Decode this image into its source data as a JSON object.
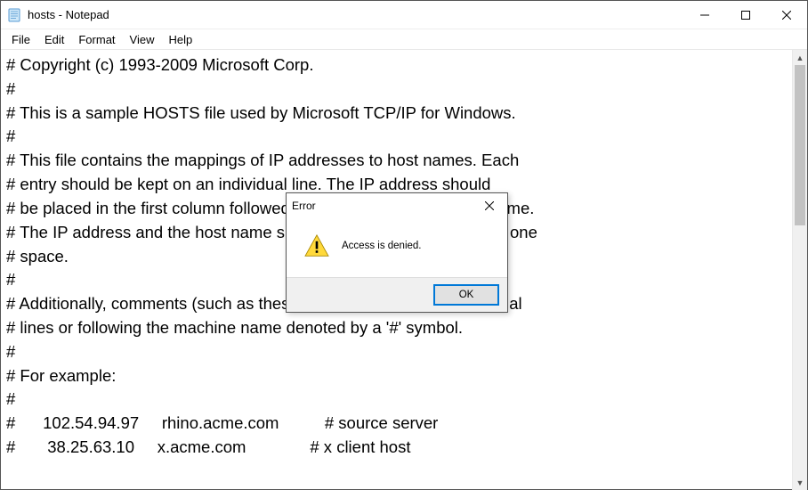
{
  "window": {
    "title": "hosts - Notepad"
  },
  "menu": {
    "file": "File",
    "edit": "Edit",
    "format": "Format",
    "view": "View",
    "help": "Help"
  },
  "editor": {
    "content": "# Copyright (c) 1993-2009 Microsoft Corp.\n#\n# This is a sample HOSTS file used by Microsoft TCP/IP for Windows.\n#\n# This file contains the mappings of IP addresses to host names. Each\n# entry should be kept on an individual line. The IP address should\n# be placed in the first column followed by the corresponding host name.\n# The IP address and the host name should be separated by at least one\n# space.\n#\n# Additionally, comments (such as these) may be inserted on individual\n# lines or following the machine name denoted by a '#' symbol.\n#\n# For example:\n#\n#      102.54.94.97     rhino.acme.com          # source server\n#       38.25.63.10     x.acme.com              # x client host"
  },
  "dialog": {
    "title": "Error",
    "message": "Access is denied.",
    "ok_label": "OK"
  }
}
